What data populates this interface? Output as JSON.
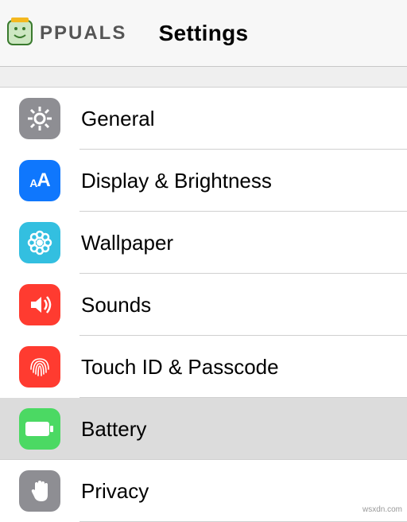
{
  "logo": {
    "text": "PPUALS"
  },
  "header": {
    "title": "Settings"
  },
  "rows": [
    {
      "label": "General"
    },
    {
      "label": "Display & Brightness"
    },
    {
      "label": "Wallpaper"
    },
    {
      "label": "Sounds"
    },
    {
      "label": "Touch ID & Passcode"
    },
    {
      "label": "Battery"
    },
    {
      "label": "Privacy"
    }
  ],
  "display_icon_text": "AA",
  "attribution": "wsxdn.com"
}
